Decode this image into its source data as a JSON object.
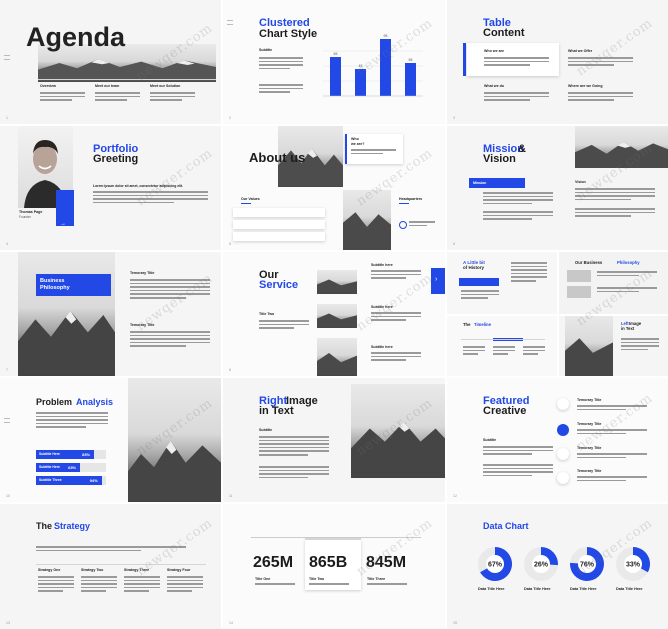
{
  "colors": {
    "accent": "#2248e6",
    "bg": "#f5f5f5"
  },
  "watermark": "newqer.com",
  "s1": {
    "title": "Agenda",
    "cols": [
      {
        "h": "Overview"
      },
      {
        "h": "Meet our team"
      },
      {
        "h": "Meet our Solution"
      }
    ]
  },
  "s2": {
    "title_blue": "Clustered",
    "title_dark": "Chart Style",
    "sub": "Subtitle",
    "chart_data": {
      "type": "bar",
      "categories": [
        "A",
        "B",
        "C",
        "D"
      ],
      "values": [
        65,
        45,
        95,
        55
      ],
      "ylim": [
        0,
        100
      ]
    }
  },
  "s3": {
    "title_blue": "Table",
    "title_dark": "Content",
    "cells": [
      "Who we are",
      "What we Offer",
      "What we do",
      "Where are we Going"
    ]
  },
  "s4": {
    "title_blue": "Portfolio",
    "title_dark": "Greeting",
    "name": "Thomas Page",
    "role": "Founder",
    "body": "Lorem ipsum dolor sit amet, consectetur adipiscing elit."
  },
  "s5": {
    "title": "About us",
    "who_blue": "Who",
    "who_dark": "we are?",
    "values": "Our Values",
    "hq": "Headquarters"
  },
  "s6": {
    "title_blue": "Mission",
    "title_amp": "&",
    "title_dark": "Vision",
    "mission": "Mission",
    "vision": "Vision"
  },
  "s7": {
    "label": "Business Philosophy",
    "t1": "Temorary Title",
    "t2": "Temorary Title"
  },
  "s8": {
    "title_dark": "Our",
    "title_blue": "Service",
    "sub1": "Subtitle here",
    "sub2": "Subtitle here",
    "sub3": "Subtitle here",
    "tag": "Title Two"
  },
  "s9": {
    "history_a": "A Little bit",
    "history_b": "of History",
    "timeline_a": "The",
    "timeline_b": "Timeline",
    "phil_a": "Our Business",
    "phil_b": "Philosophy",
    "left_a": "Left",
    "left_b": "Image",
    "left_c": "in Text"
  },
  "s10": {
    "title_dark": "Problem",
    "title_blue": "Analysis",
    "bars": [
      {
        "label": "Subtitle Here",
        "pct": "83%",
        "value": 83
      },
      {
        "label": "Subtitle Here",
        "pct": "63%",
        "value": 63
      },
      {
        "label": "Subtitle Three",
        "pct": "94%",
        "value": 94
      }
    ]
  },
  "s11": {
    "title_blue": "Right",
    "title_dark1": "Image",
    "title_dark2": "in Text",
    "sub": "Subtitle"
  },
  "s12": {
    "title_blue": "Featured",
    "title_dark": "Creative",
    "sub": "Subtitle",
    "items": [
      "Temorary Title",
      "Temorary Title",
      "Temorary Title",
      "Temorary Title"
    ]
  },
  "s13": {
    "title_dark": "The",
    "title_blue": "Strategy",
    "cols": [
      "Strategy One",
      "Strategy Two",
      "Strategy Three",
      "Strategy Four"
    ]
  },
  "s14": {
    "stats": [
      {
        "v": "265M",
        "l": "Title One"
      },
      {
        "v": "865B",
        "l": "Title Two"
      },
      {
        "v": "845M",
        "l": "Title Three"
      }
    ]
  },
  "s15": {
    "title": "Data Chart",
    "chart_data": {
      "type": "pie",
      "items": [
        {
          "pct": "67%",
          "value": 67,
          "label": "Data Title Here"
        },
        {
          "pct": "26%",
          "value": 26,
          "label": "Data Title Here"
        },
        {
          "pct": "76%",
          "value": 76,
          "label": "Data Title Here"
        },
        {
          "pct": "33%",
          "value": 33,
          "label": "Data Title Here"
        }
      ]
    }
  }
}
